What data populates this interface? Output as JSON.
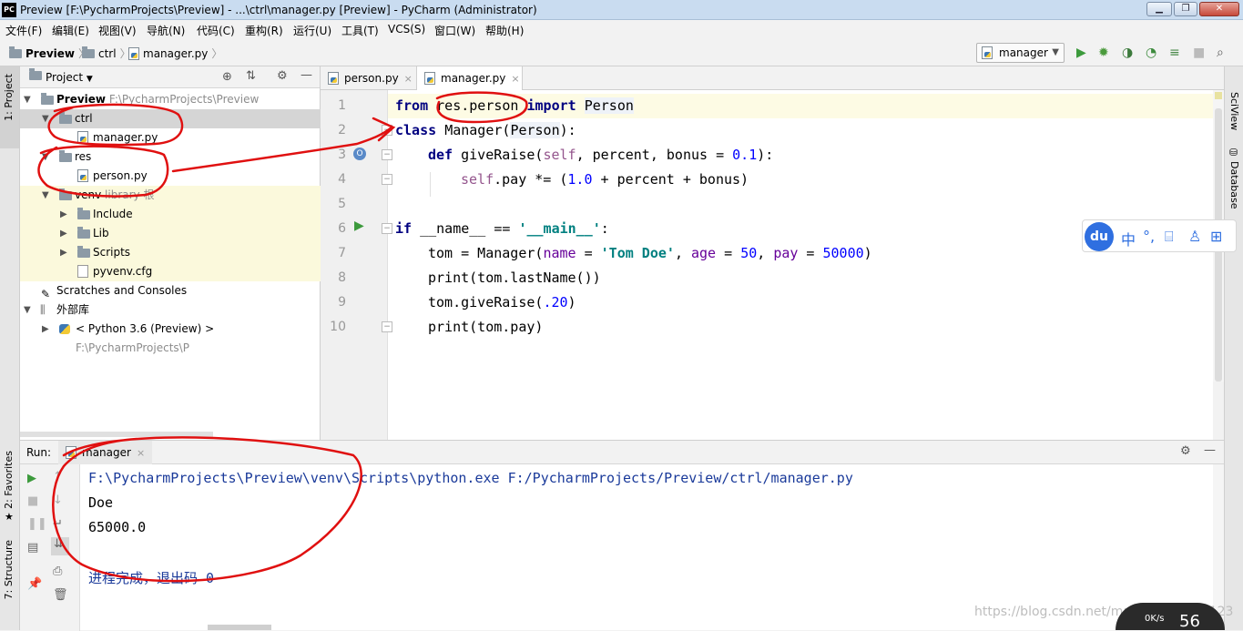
{
  "titlebar": {
    "logo": "PC",
    "title": "Preview [F:\\PycharmProjects\\Preview] - ...\\ctrl\\manager.py [Preview] - PyCharm (Administrator)"
  },
  "menu": [
    "文件(F)",
    "编辑(E)",
    "视图(V)",
    "导航(N)",
    "代码(C)",
    "重构(R)",
    "运行(U)",
    "工具(T)",
    "VCS(S)",
    "窗口(W)",
    "帮助(H)"
  ],
  "breadcrumbs": [
    "Preview",
    "ctrl",
    "manager.py"
  ],
  "run_config": "manager",
  "left_tabs": {
    "project": "1: Project",
    "favorites": "2: Favorites",
    "structure": "7: Structure"
  },
  "right_tabs": {
    "sciview": "SciView",
    "database": "Database"
  },
  "project": {
    "title": "Project",
    "root_name": "Preview",
    "root_path": "F:\\PycharmProjects\\Preview",
    "ctrl": "ctrl",
    "manager": "manager.py",
    "res": "res",
    "person": "person.py",
    "venv": "venv",
    "venv_note": "library 根",
    "include": "Include",
    "lib": "Lib",
    "scripts": "Scripts",
    "pyvenv": "pyvenv.cfg",
    "scratches": "Scratches and Consoles",
    "ext": "外部库",
    "python": "< Python 3.6 (Preview) >",
    "python_path": "F:\\PycharmProjects\\P"
  },
  "tabs": {
    "person": "person.py",
    "manager": "manager.py",
    "close": "×"
  },
  "editor": {
    "line_numbers": [
      "1",
      "2",
      "3",
      "4",
      "5",
      "6",
      "7",
      "8",
      "9",
      "10"
    ]
  },
  "code": {
    "l1": {
      "kw1": "from",
      "mod": "res.person",
      "kw2": "import",
      "name": "Person"
    },
    "l2": {
      "kw": "class",
      "name": "Manager(",
      "base": "Person",
      "end": "):"
    },
    "l3": {
      "kw": "def",
      "name": "giveRaise(",
      "self": "self",
      "rest": ", percent, bonus = ",
      "num": "0.1",
      "end": "):"
    },
    "l4": {
      "self": "self",
      "rest": ".pay *= (",
      "num": "1.0",
      "end": " + percent + bonus)"
    },
    "l6": {
      "kw": "if",
      "rest": " __name__ == ",
      "str": "'__main__'",
      "end": ":"
    },
    "l7": {
      "a": "tom = Manager(",
      "p1": "name",
      "b": " = ",
      "s1": "'Tom Doe'",
      "c": ", ",
      "p2": "age",
      "d": " = ",
      "n1": "50",
      "e": ", ",
      "p3": "pay",
      "f": " = ",
      "n2": "50000",
      "g": ")"
    },
    "l8": {
      "a": "print(tom.lastName())"
    },
    "l9": {
      "a": "tom.giveRaise(",
      "n": ".20",
      "b": ")"
    },
    "l10": {
      "a": "print(tom.pay)"
    }
  },
  "run": {
    "label": "Run:",
    "tab": "manager",
    "cmd": "F:\\PycharmProjects\\Preview\\venv\\Scripts\\python.exe F:/PycharmProjects/Preview/ctrl/manager.py",
    "out1": "Doe",
    "out2": "65000.0",
    "exit": "进程完成，退出码 0"
  },
  "ime": {
    "logo": "du",
    "mode": "中"
  },
  "watermark": "https://blog.csdn.net/machine_vision123",
  "speed": {
    "rate": "0K/s",
    "value": "56"
  }
}
